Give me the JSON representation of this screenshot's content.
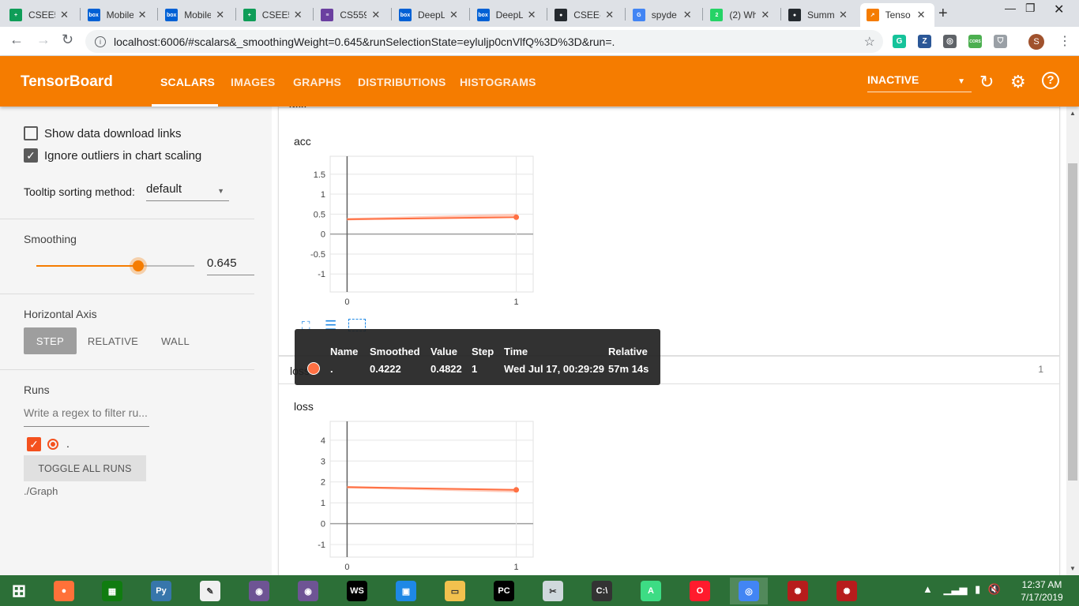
{
  "browser": {
    "tabs": [
      {
        "label": "CSEE5",
        "favicon": "sheets-icon",
        "color": "#0f9d58",
        "glyph": "+"
      },
      {
        "label": "Mobile",
        "favicon": "box-icon",
        "color": "#0061d5",
        "glyph": "box"
      },
      {
        "label": "Mobile",
        "favicon": "box-icon",
        "color": "#0061d5",
        "glyph": "box"
      },
      {
        "label": "CSEE5",
        "favicon": "sheets-icon",
        "color": "#0f9d58",
        "glyph": "+"
      },
      {
        "label": "CS559",
        "favicon": "slides-icon",
        "color": "#6b3fa0",
        "glyph": "≡"
      },
      {
        "label": "DeepL",
        "favicon": "box-icon",
        "color": "#0061d5",
        "glyph": "box"
      },
      {
        "label": "DeepL",
        "favicon": "box-icon",
        "color": "#0061d5",
        "glyph": "box"
      },
      {
        "label": "CSEE-",
        "favicon": "github-icon",
        "color": "#24292e",
        "glyph": "●"
      },
      {
        "label": "spyde",
        "favicon": "google-icon",
        "color": "#4285f4",
        "glyph": "G"
      },
      {
        "label": "(2) Wh",
        "favicon": "whatsapp-icon",
        "color": "#25d366",
        "glyph": "2"
      },
      {
        "label": "Summ",
        "favicon": "github-icon",
        "color": "#24292e",
        "glyph": "●"
      },
      {
        "label": "Tenso",
        "favicon": "tensorboard-icon",
        "color": "#f57c00",
        "glyph": "↗",
        "active": true
      }
    ],
    "url": "localhost:6006/#scalars&_smoothingWeight=0.645&runSelectionState=eyluljp0cnVlfQ%3D%3D&run=.",
    "extensions": [
      {
        "name": "grammarly-icon",
        "color": "#15c39a",
        "glyph": "G"
      },
      {
        "name": "zotero-icon",
        "color": "#2b5797",
        "glyph": "Z"
      },
      {
        "name": "chrome-ext-icon",
        "color": "#5f6368",
        "glyph": "◎"
      },
      {
        "name": "cors-icon",
        "color": "#4caf50",
        "glyph": "CORS"
      },
      {
        "name": "shield-icon",
        "color": "#9aa0a6",
        "glyph": "⛉"
      }
    ],
    "profile_initial": "S"
  },
  "header": {
    "title": "TensorBoard",
    "tabs": [
      "SCALARS",
      "IMAGES",
      "GRAPHS",
      "DISTRIBUTIONS",
      "HISTOGRAMS"
    ],
    "active_tab": "SCALARS",
    "status_select": "INACTIVE",
    "accent": "#f57c00"
  },
  "sidebar": {
    "show_download_links": {
      "label": "Show data download links",
      "checked": false
    },
    "ignore_outliers": {
      "label": "Ignore outliers in chart scaling",
      "checked": true
    },
    "tooltip_sorting": {
      "label": "Tooltip sorting method:",
      "value": "default"
    },
    "smoothing": {
      "label": "Smoothing",
      "value": "0.645",
      "fraction": 0.645
    },
    "horizontal_axis": {
      "label": "Horizontal Axis",
      "options": [
        "STEP",
        "RELATIVE",
        "WALL"
      ],
      "selected": "STEP"
    },
    "runs": {
      "label": "Runs",
      "filter_placeholder": "Write a regex to filter ru...",
      "items": [
        {
          "name": ".",
          "checked": true,
          "color": "#f4511e"
        }
      ],
      "toggle_all_label": "TOGGLE ALL RUNS",
      "log_dir": "./Graph"
    }
  },
  "main": {
    "acc_category": {
      "header": "acc"
    },
    "loss_category": {
      "header": "loss",
      "count": "1"
    }
  },
  "tooltip": {
    "headers": [
      "Name",
      "Smoothed",
      "Value",
      "Step",
      "Time",
      "Relative"
    ],
    "row": {
      "name": ".",
      "smoothed": "0.4222",
      "value": "0.4822",
      "step": "1",
      "time": "Wed Jul 17, 00:29:29",
      "relative": "57m 14s"
    }
  },
  "chart_data": [
    {
      "type": "line",
      "title": "acc",
      "xlabel": "",
      "ylabel": "",
      "x_ticks": [
        "0",
        "1"
      ],
      "y_ticks": [
        "1.5",
        "1",
        "0.5",
        "0",
        "-0.5",
        "-1"
      ],
      "xlim": [
        -0.1,
        1.1
      ],
      "ylim": [
        -1.45,
        1.95
      ],
      "series": [
        {
          "values": [
            [
              0,
              0.37
            ],
            [
              1,
              0.4222
            ]
          ],
          "color": "#ff7043",
          "style": "smoothed"
        },
        {
          "values": [
            [
              0,
              0.37
            ],
            [
              1,
              0.4822
            ]
          ],
          "color": "#ffccbc",
          "style": "raw"
        }
      ],
      "highlight_point": [
        1,
        0.4222
      ],
      "grid": true
    },
    {
      "type": "line",
      "title": "loss",
      "xlabel": "",
      "ylabel": "",
      "x_ticks": [
        "0",
        "1"
      ],
      "y_ticks": [
        "4",
        "3",
        "2",
        "1",
        "0",
        "-1"
      ],
      "xlim": [
        -0.1,
        1.1
      ],
      "ylim": [
        -1.6,
        4.9
      ],
      "series": [
        {
          "values": [
            [
              0,
              1.75
            ],
            [
              1,
              1.62
            ]
          ],
          "color": "#ff7043",
          "style": "smoothed"
        },
        {
          "values": [
            [
              0,
              1.75
            ],
            [
              1,
              1.55
            ]
          ],
          "color": "#ffccbc",
          "style": "raw"
        }
      ],
      "highlight_point": [
        1,
        1.62
      ],
      "grid": true
    }
  ],
  "taskbar": {
    "apps": [
      {
        "name": "windows-start-icon",
        "color": "#2c6f37",
        "glyph": "⊞"
      },
      {
        "name": "firefox-icon",
        "color": "#ff7139",
        "glyph": "●"
      },
      {
        "name": "store-icon",
        "color": "#107c10",
        "glyph": "▦"
      },
      {
        "name": "python-icon",
        "color": "#3776ab",
        "glyph": "Py"
      },
      {
        "name": "notepad-icon",
        "color": "#f0f0f0",
        "glyph": "✎"
      },
      {
        "name": "github-desktop-icon",
        "color": "#6e5494",
        "glyph": "◉"
      },
      {
        "name": "github-desktop-icon-2",
        "color": "#6e5494",
        "glyph": "◉"
      },
      {
        "name": "webstorm-icon",
        "color": "#000000",
        "glyph": "WS"
      },
      {
        "name": "terminal-app-icon",
        "color": "#1e88e5",
        "glyph": "▣"
      },
      {
        "name": "file-explorer-icon",
        "color": "#f2c14e",
        "glyph": "▭"
      },
      {
        "name": "pycharm-icon",
        "color": "#000000",
        "glyph": "PC"
      },
      {
        "name": "snipping-tool-icon",
        "color": "#cfd8dc",
        "glyph": "✂"
      },
      {
        "name": "cmd-icon",
        "color": "#333333",
        "glyph": "C:\\"
      },
      {
        "name": "android-studio-icon",
        "color": "#3ddc84",
        "glyph": "A"
      },
      {
        "name": "opera-icon",
        "color": "#ff1b2d",
        "glyph": "O"
      },
      {
        "name": "chrome-icon",
        "color": "#4285f4",
        "glyph": "◎",
        "active": true
      },
      {
        "name": "spider-icon",
        "color": "#b71c1c",
        "glyph": "✺"
      },
      {
        "name": "spider-icon-2",
        "color": "#b71c1c",
        "glyph": "✺"
      }
    ],
    "clock_time": "12:37 AM",
    "clock_date": "7/17/2019"
  }
}
